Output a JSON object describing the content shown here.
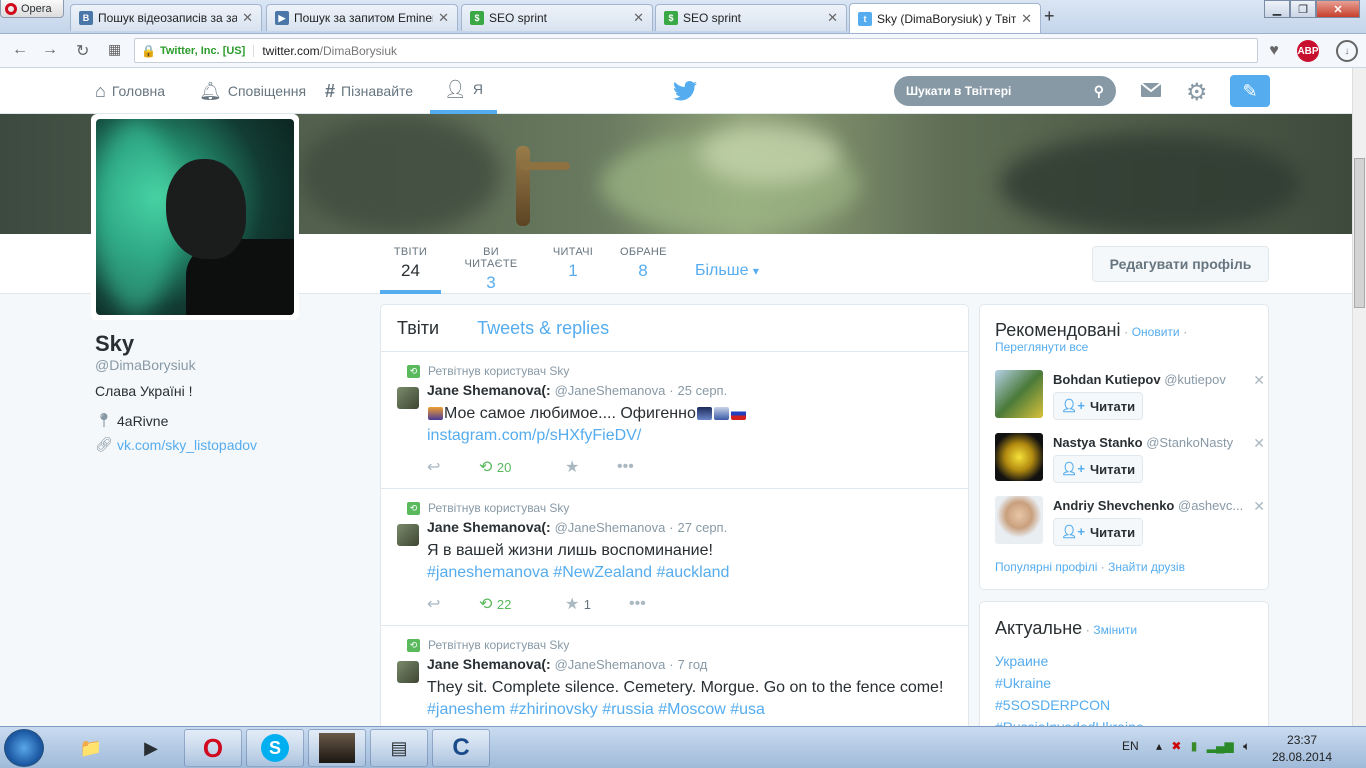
{
  "browser": {
    "menu_label": "Opera",
    "tabs": [
      {
        "title": "Пошук відеозаписів за запитом",
        "icon": "vk-icon",
        "color": "#4a76a8",
        "letter": "B"
      },
      {
        "title": "Пошук за запитом Eminem",
        "icon": "vk-video-icon",
        "color": "#4a76a8",
        "letter": "▶"
      },
      {
        "title": "SEO sprint",
        "icon": "seosprint-icon",
        "color": "#3aa845",
        "letter": "$"
      },
      {
        "title": "SEO sprint",
        "icon": "seosprint-icon",
        "color": "#3aa845",
        "letter": "$"
      },
      {
        "title": "Sky (DimaBorysiuk) у Твіттері",
        "icon": "twitter-icon",
        "color": "#55acee",
        "letter": "t"
      }
    ],
    "cert": "Twitter, Inc. [US]",
    "url_host": "twitter.com",
    "url_path": "/DimaBorysiuk",
    "adblock_label": "ABP"
  },
  "topnav": {
    "home": "Головна",
    "notifications": "Сповіщення",
    "discover": "Пізнавайте",
    "me": "Я",
    "search_placeholder": "Шукати в Твіттері"
  },
  "profile_nav": {
    "stats": [
      {
        "label": "ТВІТИ",
        "value": "24"
      },
      {
        "label": "ВИ ЧИТАЄТЕ",
        "value": "3"
      },
      {
        "label": "ЧИТАЧІ",
        "value": "1"
      },
      {
        "label": "ОБРАНЕ",
        "value": "8"
      }
    ],
    "more": "Більше",
    "edit_profile": "Редагувати профіль"
  },
  "profile": {
    "name": "Sky",
    "handle": "@DimaBorysiuk",
    "bio": "Слава Україні !",
    "location": "4aRivne",
    "website": "vk.com/sky_listopadov"
  },
  "timeline": {
    "tab_tweets": "Твіти",
    "tab_replies": "Tweets & replies",
    "tweets": [
      {
        "retweet_label": "Ретвітнув користувач Sky",
        "name": "Jane Shemanova(:",
        "handle": "@JaneShemanova",
        "time": "25 серп.",
        "text": "Мое самое любимое.... Офигенно",
        "link": "instagram.com/p/sHXfyFieDV/",
        "retweets": "20",
        "favorites": ""
      },
      {
        "retweet_label": "Ретвітнув користувач Sky",
        "name": "Jane Shemanova(:",
        "handle": "@JaneShemanova",
        "time": "27 серп.",
        "text": "Я в вашей жизни лишь воспоминание!",
        "link": "#janeshemanova #NewZealand #auckland",
        "retweets": "22",
        "favorites": "1"
      },
      {
        "retweet_label": "Ретвітнув користувач Sky",
        "name": "Jane Shemanova(:",
        "handle": "@JaneShemanova",
        "time": "7 год",
        "text": "They sit. Complete silence. Cemetery. Morgue. Go on to the fence come!",
        "link": "#janeshem #zhirinovsky #russia #Moscow #usa",
        "retweets": "",
        "favorites": ""
      }
    ]
  },
  "recommended": {
    "title": "Рекомендовані",
    "refresh": "Оновити",
    "view_all": "Переглянути все",
    "follow_label": "Читати",
    "people": [
      {
        "name": "Bohdan Kutiepov",
        "handle": "@kutiepov"
      },
      {
        "name": "Nastya Stanko",
        "handle": "@StankoNasty"
      },
      {
        "name": "Andriy Shevchenko",
        "handle": "@ashevc..."
      }
    ],
    "footer_popular": "Популярні профілі",
    "footer_find": "Знайти друзів"
  },
  "trends": {
    "title": "Актуальне",
    "change": "Змінити",
    "items": [
      "Украине",
      "#Ukraine",
      "#5SOSDERPCON",
      "#RussiaInvadedUkraine"
    ]
  },
  "taskbar": {
    "lang": "EN",
    "time": "23:37",
    "date": "28.08.2014"
  }
}
